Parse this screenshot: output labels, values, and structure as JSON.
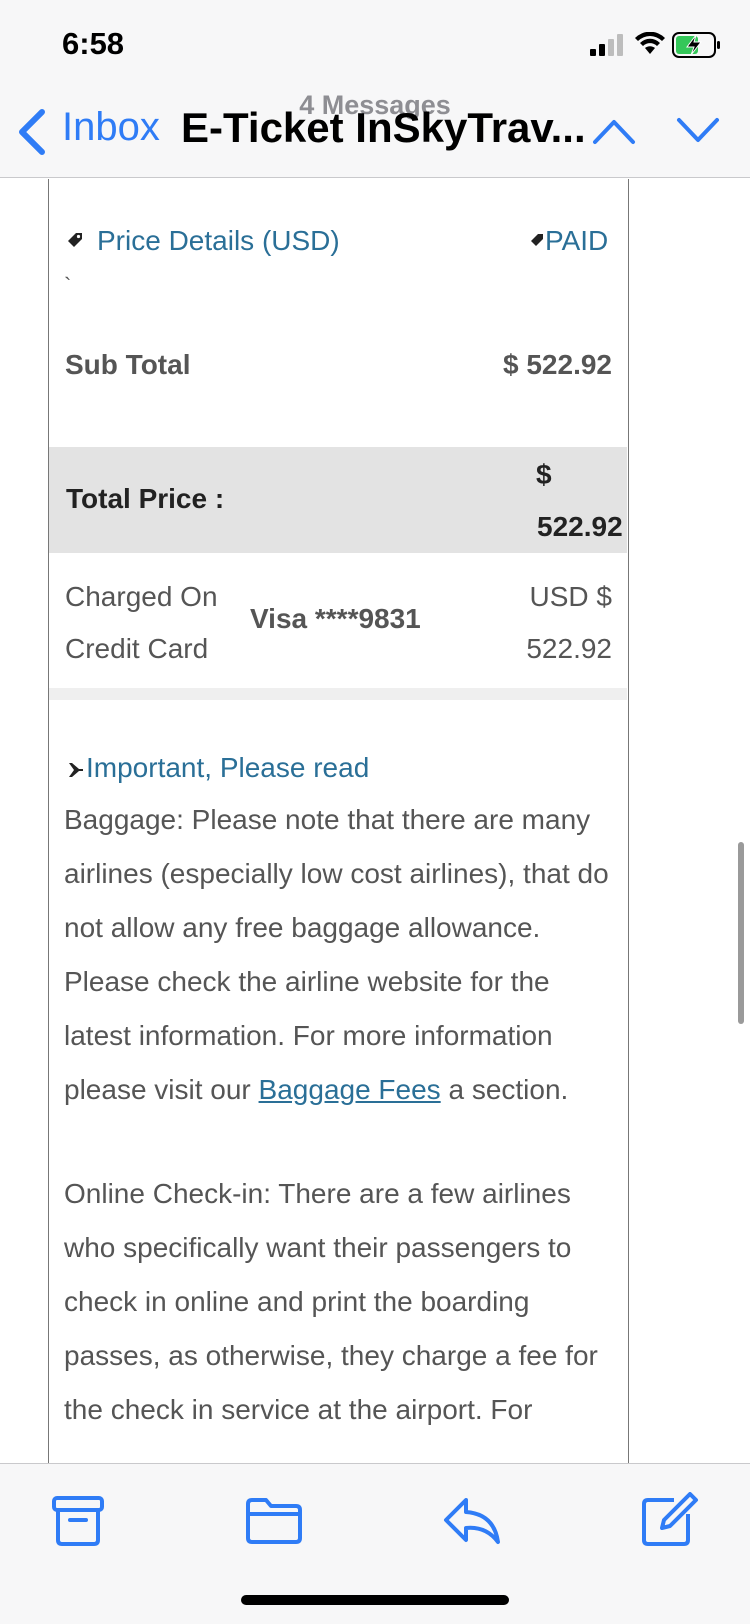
{
  "status_bar": {
    "time": "6:58",
    "icons": [
      "signal-icon",
      "wifi-icon",
      "battery-charging-icon"
    ]
  },
  "nav": {
    "back_label": "Inbox",
    "messages_count": "4 Messages",
    "subject": "E-Ticket InSkyTrav...",
    "icons": [
      "back-chevron-icon",
      "previous-message-icon",
      "next-message-icon"
    ]
  },
  "price_details": {
    "header": "Price Details (USD)",
    "status": "PAID",
    "stray_mark": "`",
    "subtotal_label": "Sub Total",
    "subtotal_value": "$ 522.92",
    "total_label": "Total Price :",
    "total_currency": "$",
    "total_value": "522.92",
    "charged_label": "Charged On Credit Card",
    "card": "Visa ****9831",
    "charged_value": "USD $ 522.92"
  },
  "important": {
    "header": "Important, Please read",
    "baggage_text": "Baggage: Please note that there are many airlines (especially low cost airlines), that do not allow any free baggage allowance. Please check the airline website for the latest information. For more information please visit our",
    "baggage_link": "Baggage Fees",
    "baggage_suffix": " a section.",
    "checkin_text": "Online Check-in: There are a few airlines who specifically want their passengers to check in online and print the boarding passes, as otherwise, they charge a fee for the check in service at the airport. For"
  },
  "toolbar": {
    "icons": [
      "archive-icon",
      "folder-icon",
      "reply-icon",
      "compose-icon"
    ]
  },
  "colors": {
    "accent": "#2f7cf6",
    "link": "#2a6f97",
    "total_row_bg": "#e3e3e3"
  }
}
